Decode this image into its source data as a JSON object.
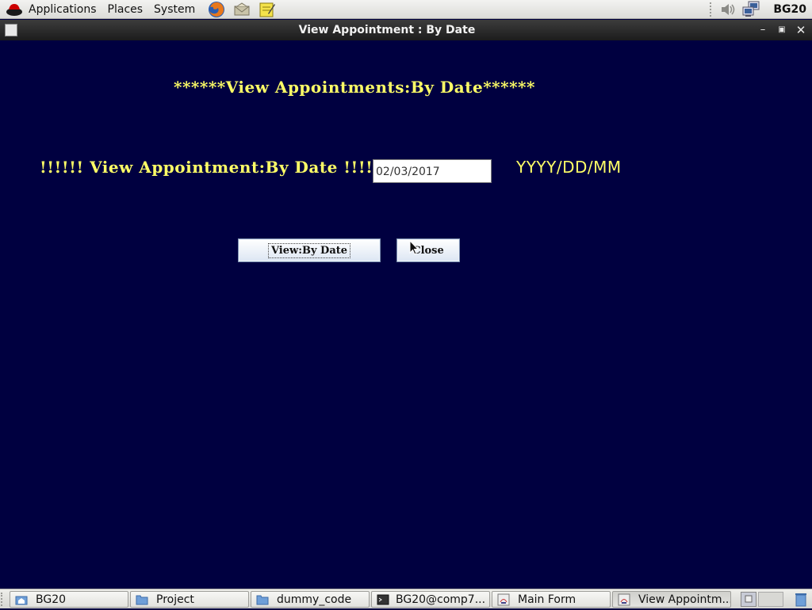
{
  "top_panel": {
    "menus": [
      "Applications",
      "Places",
      "System"
    ],
    "user": "BG20"
  },
  "window": {
    "title": "View Appointment : By Date"
  },
  "form": {
    "heading": "******View Appointments:By Date******",
    "date_label": "!!!!!! View Appointment:By Date !!!!!!",
    "date_value": "02/03/2017",
    "format_hint": "YYYY/DD/MM",
    "view_button": "View:By Date",
    "close_button": "Close"
  },
  "taskbar": {
    "tasks": [
      {
        "label": "BG20",
        "icon": "home-folder-icon"
      },
      {
        "label": "Project",
        "icon": "folder-icon"
      },
      {
        "label": "dummy_code",
        "icon": "folder-icon"
      },
      {
        "label": "BG20@comp7...",
        "icon": "terminal-icon"
      },
      {
        "label": "Main Form",
        "icon": "java-app-icon"
      },
      {
        "label": "View Appointm...",
        "icon": "java-app-icon"
      }
    ]
  },
  "colors": {
    "background": "#000040",
    "text_accent": "#ffff66"
  }
}
